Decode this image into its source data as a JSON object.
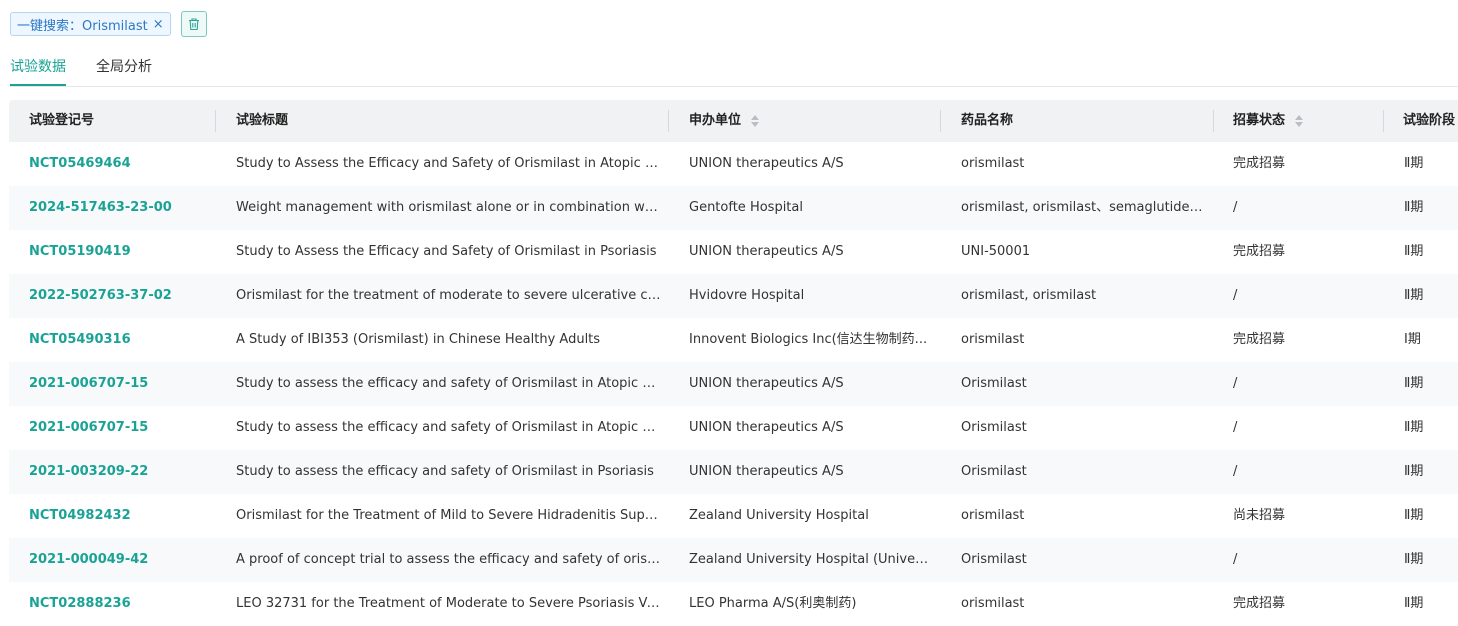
{
  "filter": {
    "tag_label": "一键搜索：Orismilast",
    "close_glyph": "×"
  },
  "tabs": [
    {
      "label": "试验数据",
      "active": true
    },
    {
      "label": "全局分析",
      "active": false
    }
  ],
  "table": {
    "columns": [
      "试验登记号",
      "试验标题",
      "申办单位",
      "药品名称",
      "招募状态",
      "试验阶段"
    ],
    "rows": [
      {
        "id": "NCT05469464",
        "title": "Study to Assess the Efficacy and Safety of Orismilast in Atopic Der...",
        "sponsor": "UNION therapeutics A/S",
        "drug": "orismilast",
        "status": "完成招募",
        "phase": "Ⅱ期"
      },
      {
        "id": "2024-517463-23-00",
        "title": "Weight management with orismilast alone or in combination with...",
        "sponsor": "Gentofte Hospital",
        "drug": "orismilast, orismilast、semaglutide、...",
        "status": "/",
        "phase": "Ⅱ期"
      },
      {
        "id": "NCT05190419",
        "title": "Study to Assess the Efficacy and Safety of Orismilast in Psoriasis",
        "sponsor": "UNION therapeutics A/S",
        "drug": "UNI-50001",
        "status": "完成招募",
        "phase": "Ⅱ期"
      },
      {
        "id": "2022-502763-37-02",
        "title": "Orismilast for the treatment of moderate to severe ulcerative colitis",
        "sponsor": "Hvidovre Hospital",
        "drug": "orismilast, orismilast",
        "status": "/",
        "phase": "Ⅱ期"
      },
      {
        "id": "NCT05490316",
        "title": "A Study of IBI353 (Orismilast) in Chinese Healthy Adults",
        "sponsor": "Innovent Biologics Inc(信达生物制药...",
        "drug": "orismilast",
        "status": "完成招募",
        "phase": "Ⅰ期"
      },
      {
        "id": "2021-006707-15",
        "title": "Study to assess the efficacy and safety of Orismilast in Atopic Der...",
        "sponsor": "UNION therapeutics A/S",
        "drug": "Orismilast",
        "status": "/",
        "phase": "Ⅱ期"
      },
      {
        "id": "2021-006707-15",
        "title": "Study to assess the efficacy and safety of Orismilast in Atopic Der...",
        "sponsor": "UNION therapeutics A/S",
        "drug": "Orismilast",
        "status": "/",
        "phase": "Ⅱ期"
      },
      {
        "id": "2021-003209-22",
        "title": "Study to assess the efficacy and safety of Orismilast in Psoriasis",
        "sponsor": "UNION therapeutics A/S",
        "drug": "Orismilast",
        "status": "/",
        "phase": "Ⅱ期"
      },
      {
        "id": "NCT04982432",
        "title": "Orismilast for the Treatment of Mild to Severe Hidradenitis Suppu...",
        "sponsor": "Zealand University Hospital",
        "drug": "orismilast",
        "status": "尚未招募",
        "phase": "Ⅱ期"
      },
      {
        "id": "2021-000049-42",
        "title": "A proof of concept trial to assess the efficacy and safety of orismil...",
        "sponsor": "Zealand University Hospital (Universi...",
        "drug": "Orismilast",
        "status": "/",
        "phase": "Ⅱ期"
      },
      {
        "id": "NCT02888236",
        "title": "LEO 32731 for the Treatment of Moderate to Severe Psoriasis Vul...",
        "sponsor": "LEO Pharma A/S(利奥制药)",
        "drug": "orismilast",
        "status": "完成招募",
        "phase": "Ⅱ期"
      }
    ]
  },
  "colors": {
    "accent": "#1aa395",
    "tag_text": "#2b78c5",
    "header_bg": "#f0f2f3",
    "alt_row_bg": "#f8f9fa"
  }
}
